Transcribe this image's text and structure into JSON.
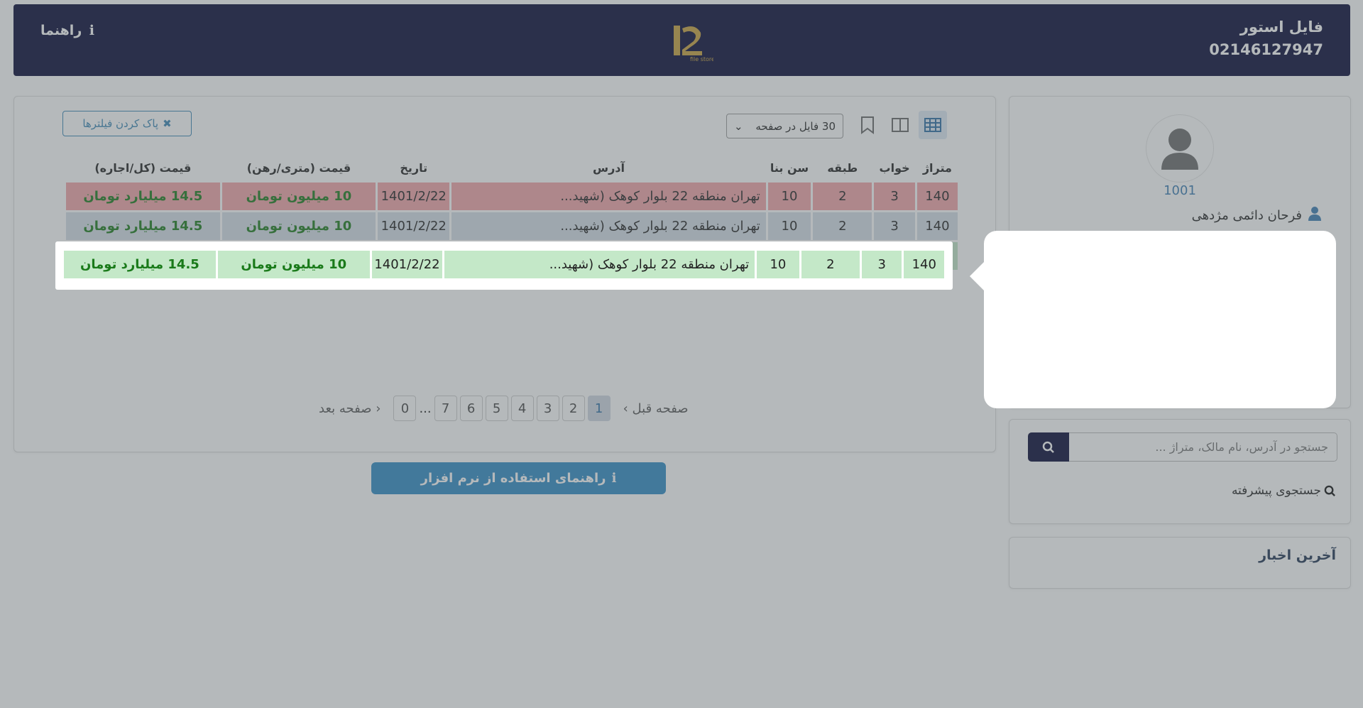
{
  "header": {
    "brand_name": "فایل استور",
    "phone": "02146127947",
    "help_label": "راهنما"
  },
  "toolbar": {
    "per_page_label": "30 فایل در صفحه",
    "clear_filters_label": "پاک کردن فیلترها"
  },
  "table": {
    "headers": [
      "متراژ",
      "خواب",
      "طبقه",
      "سن بنا",
      "آدرس",
      "تاریخ",
      "قیمت (متری/رهن)",
      "قیمت (کل/اجاره)"
    ],
    "rows": [
      {
        "area": "140",
        "beds": "3",
        "floor": "2",
        "age": "10",
        "address": "تهران منطقه 22 بلوار کوهک (شهید...",
        "date": "1401/2/22",
        "price_unit": "10 میلیون تومان",
        "price_total": "14.5 میلیارد تومان",
        "status": "red"
      },
      {
        "area": "140",
        "beds": "3",
        "floor": "2",
        "age": "10",
        "address": "تهران منطقه 22 بلوار کوهک (شهید...",
        "date": "1401/2/22",
        "price_unit": "10 میلیون تومان",
        "price_total": "14.5 میلیارد تومان",
        "status": "gray"
      },
      {
        "area": "140",
        "beds": "3",
        "floor": "2",
        "age": "10",
        "address": "تهران منطقه 22 بلوار کوهک (شهید...",
        "date": "1401/2/22",
        "price_unit": "10 میلیون تومان",
        "price_total": "14.5 میلیارد تومان",
        "status": "green"
      }
    ]
  },
  "pagination": {
    "prev_label": "‹ صفحه قبل",
    "next_label": "صفحه بعد ›",
    "pages": [
      "1",
      "2",
      "3",
      "4",
      "5",
      "6",
      "7",
      "...",
      "0"
    ],
    "active_page": "1"
  },
  "guide_button_label": "راهنمای استفاده از نرم افزار",
  "profile": {
    "user_id": "1001",
    "user_name": "فرحان دائمی مژدهی"
  },
  "search": {
    "placeholder": "جستجو در آدرس، نام مالک، متراژ ...",
    "advanced_label": "جستجوی پیشرفته"
  },
  "news": {
    "title": "آخرین اخبار"
  },
  "colors": {
    "header_bg": "#050734",
    "accent": "#2f8ac5",
    "row_red": "#f2a4a8",
    "row_gray": "#d6dfe7",
    "row_green": "#c4e8c8",
    "price_green": "#1a7a1a"
  }
}
